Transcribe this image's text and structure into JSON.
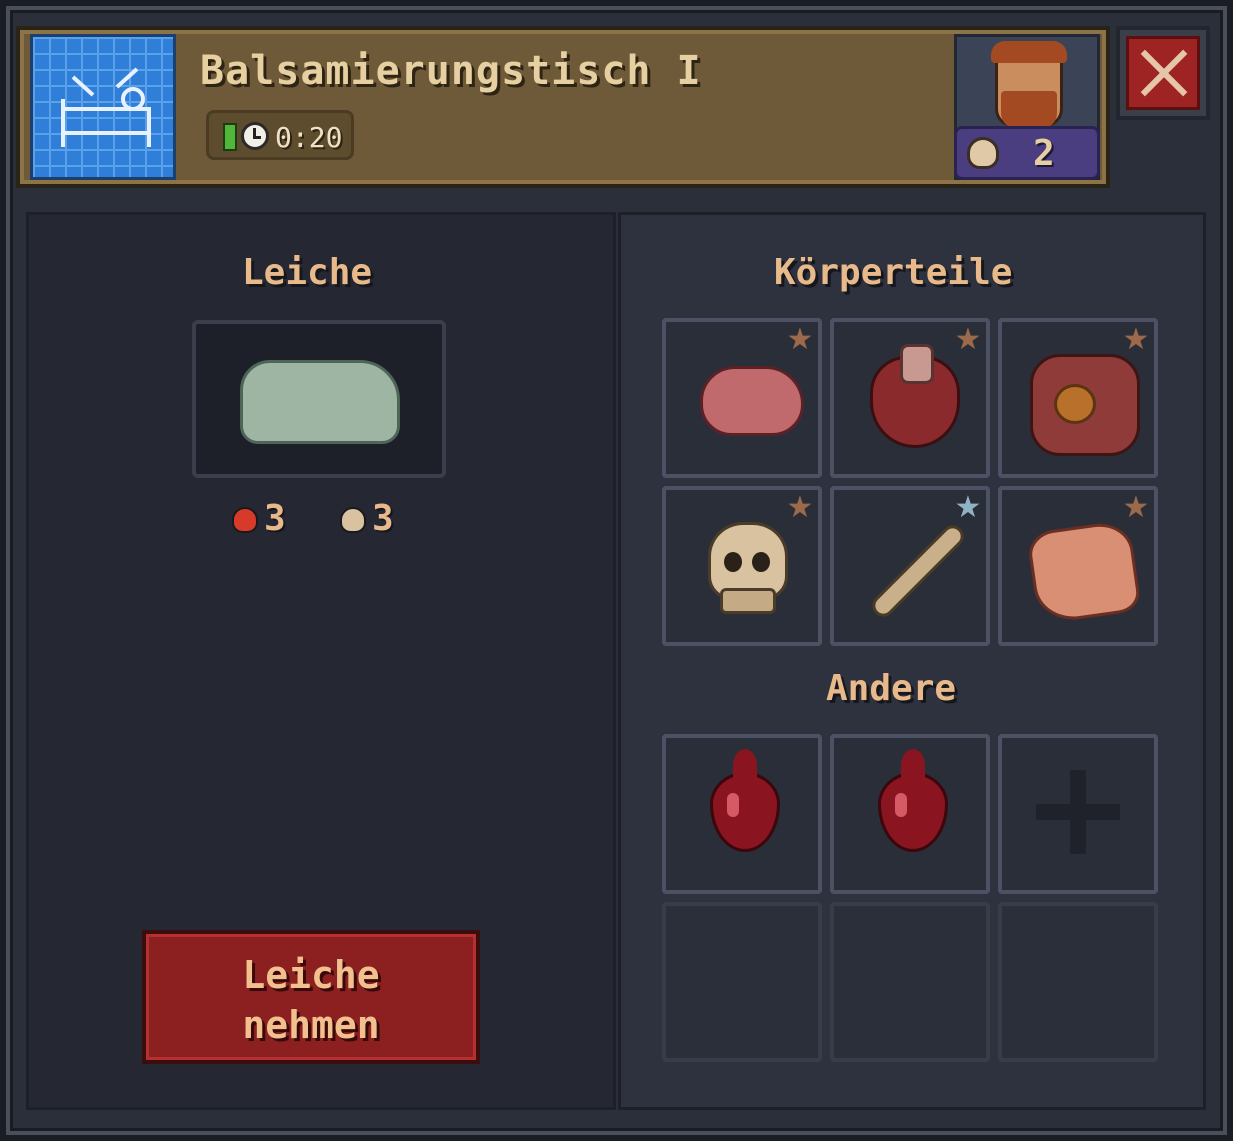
{
  "header": {
    "title": "Balsamierungstisch I",
    "timer": "0:20",
    "worker_count": "2",
    "icons": [
      "blueprint-bed-icon",
      "timer-icon",
      "clock-icon",
      "worker-portrait",
      "skull-icon",
      "close-icon"
    ]
  },
  "left": {
    "heading": "Leiche",
    "corpse_icon": "wrapped-corpse-icon",
    "red_skull_value": "3",
    "white_skull_value": "3",
    "take_button": {
      "line1": "Leiche",
      "line2": "nehmen"
    }
  },
  "right": {
    "body_parts_heading": "Körperteile",
    "body_parts": [
      {
        "icon": "brain-icon",
        "star": "bronze"
      },
      {
        "icon": "heart-icon",
        "star": "bronze"
      },
      {
        "icon": "intestines-icon",
        "star": "bronze"
      },
      {
        "icon": "skull-icon",
        "star": "bronze"
      },
      {
        "icon": "bone-icon",
        "star": "silver"
      },
      {
        "icon": "skin-icon",
        "star": "bronze"
      }
    ],
    "other_heading": "Andere",
    "other_items": [
      {
        "icon": "blood-drop-icon"
      },
      {
        "icon": "blood-drop-icon"
      },
      {
        "icon": "plus-icon"
      }
    ]
  },
  "colors": {
    "accent_text": "#e8b98a",
    "header_bg": "#6e5a38",
    "button_red": "#8c1f1f",
    "bronze_star": "#9c6a4a",
    "silver_star": "#8fb3c4"
  }
}
